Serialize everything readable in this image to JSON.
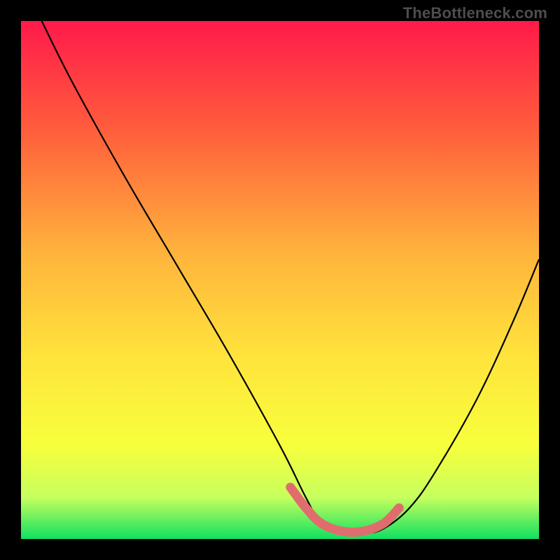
{
  "watermark": "TheBottleneck.com",
  "colors": {
    "gradient_stops": [
      {
        "offset": "0%",
        "color": "#ff1a4b"
      },
      {
        "offset": "20%",
        "color": "#ff5a3c"
      },
      {
        "offset": "45%",
        "color": "#ffb43c"
      },
      {
        "offset": "65%",
        "color": "#ffe43c"
      },
      {
        "offset": "82%",
        "color": "#f7ff3c"
      },
      {
        "offset": "92%",
        "color": "#c6ff5e"
      },
      {
        "offset": "100%",
        "color": "#10e060"
      }
    ],
    "curve": "#000000",
    "band": "#e06d6d",
    "frame": "#000000"
  },
  "chart_data": {
    "type": "line",
    "title": "",
    "xlabel": "",
    "ylabel": "",
    "xlim": [
      0,
      100
    ],
    "ylim": [
      0,
      100
    ],
    "series": [
      {
        "name": "bottleneck-curve",
        "x": [
          4,
          10,
          20,
          30,
          40,
          50,
          55,
          58,
          62,
          66,
          70,
          75,
          80,
          88,
          95,
          100
        ],
        "y": [
          100,
          88,
          70,
          53,
          36,
          18,
          8,
          3,
          1,
          1,
          2,
          6,
          13,
          27,
          42,
          54
        ]
      }
    ],
    "annotations": [
      {
        "name": "optimal-band",
        "x": [
          52,
          55,
          58,
          62,
          66,
          70,
          73
        ],
        "y": [
          10,
          6,
          3,
          1.5,
          1.5,
          3,
          6
        ]
      }
    ]
  }
}
